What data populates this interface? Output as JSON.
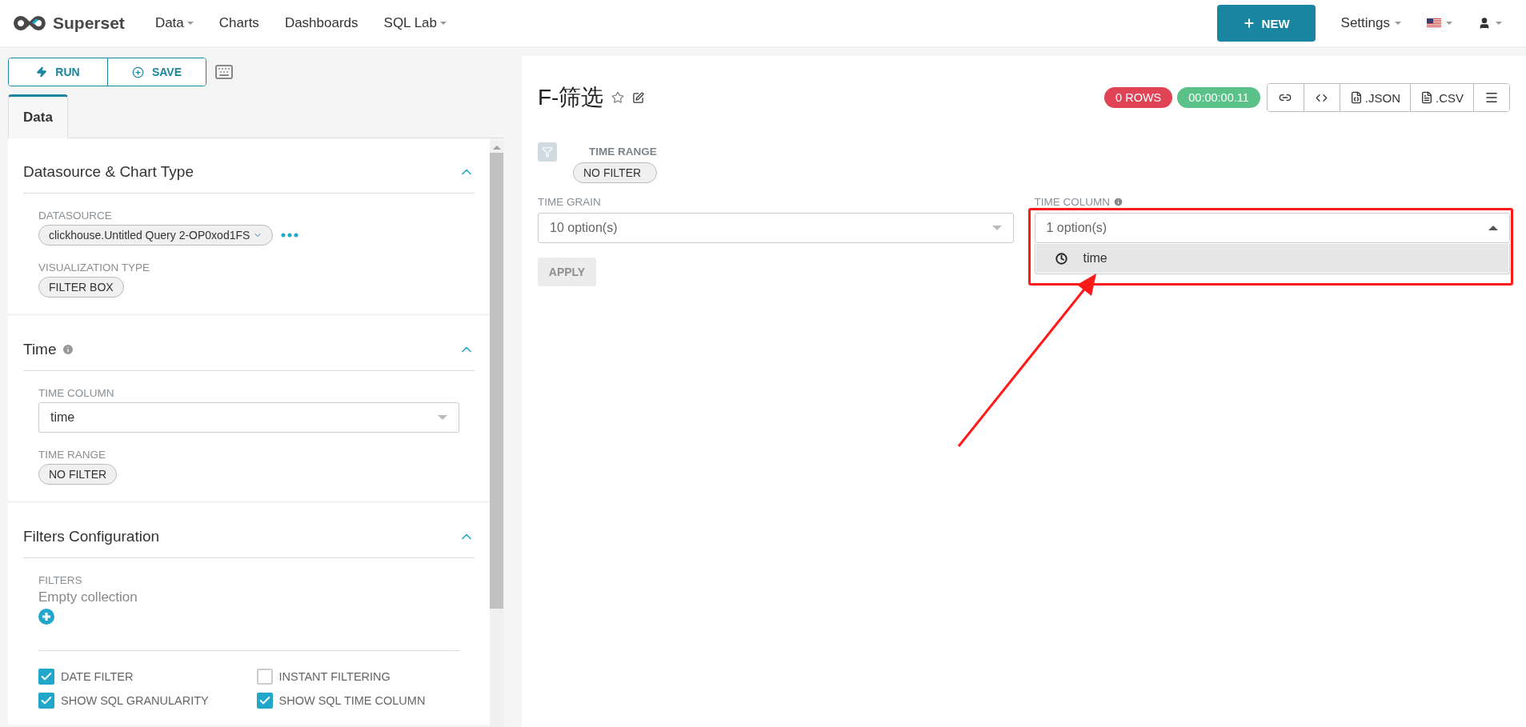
{
  "header": {
    "brand": "Superset",
    "nav": [
      {
        "label": "Data",
        "dropdown": true
      },
      {
        "label": "Charts",
        "dropdown": false
      },
      {
        "label": "Dashboards",
        "dropdown": false
      },
      {
        "label": "SQL Lab",
        "dropdown": true
      }
    ],
    "new_button": "NEW",
    "settings": "Settings"
  },
  "toolbar": [
    {
      "kind": "run",
      "label": "RUN"
    },
    {
      "kind": "save",
      "label": "SAVE"
    }
  ],
  "tabs": [
    {
      "label": "Data",
      "selected": true
    }
  ],
  "sections": [
    {
      "title": "Datasource & Chart Type",
      "info": false,
      "expanded": true,
      "controls": [
        {
          "kind": "datasource",
          "label": "DATASOURCE",
          "value": "clickhouse.Untitled Query 2-OP0xod1FS"
        },
        {
          "kind": "pill",
          "label": "VISUALIZATION TYPE",
          "value": "FILTER BOX"
        }
      ]
    },
    {
      "title": "Time",
      "info": true,
      "expanded": true,
      "controls": [
        {
          "kind": "select",
          "label": "TIME COLUMN",
          "value": "time"
        },
        {
          "kind": "pill",
          "label": "TIME RANGE",
          "value": "NO FILTER"
        }
      ]
    },
    {
      "title": "Filters Configuration",
      "info": false,
      "expanded": true,
      "controls": [
        {
          "kind": "collection",
          "label": "FILTERS",
          "value": "Empty collection"
        },
        {
          "kind": "checkboxes",
          "items": [
            {
              "label": "DATE FILTER",
              "checked": true
            },
            {
              "label": "INSTANT FILTERING",
              "checked": false
            },
            {
              "label": "SHOW SQL GRANULARITY",
              "checked": true
            },
            {
              "label": "SHOW SQL TIME COLUMN",
              "checked": true
            }
          ]
        }
      ]
    }
  ],
  "chart": {
    "title": "F-筛选",
    "rows_badge": "0 ROWS",
    "time_badge": "00:00:00.11",
    "actions": [
      {
        "kind": "link"
      },
      {
        "kind": "code"
      },
      {
        "kind": "json",
        "label": ".JSON"
      },
      {
        "kind": "csv",
        "label": ".CSV"
      },
      {
        "kind": "menu"
      }
    ],
    "time_range": {
      "label": "TIME RANGE",
      "value": "NO FILTER"
    },
    "time_grain": {
      "label": "TIME GRAIN",
      "value": "10 option(s)",
      "expanded": false
    },
    "time_column": {
      "label": "TIME COLUMN",
      "info": true,
      "value": "1 option(s)",
      "expanded": true,
      "options": [
        {
          "label": "time",
          "selected": true
        }
      ]
    },
    "apply_button": {
      "label": "APPLY",
      "disabled": true
    }
  },
  "annotation": {
    "frame": true,
    "arrow": true
  }
}
